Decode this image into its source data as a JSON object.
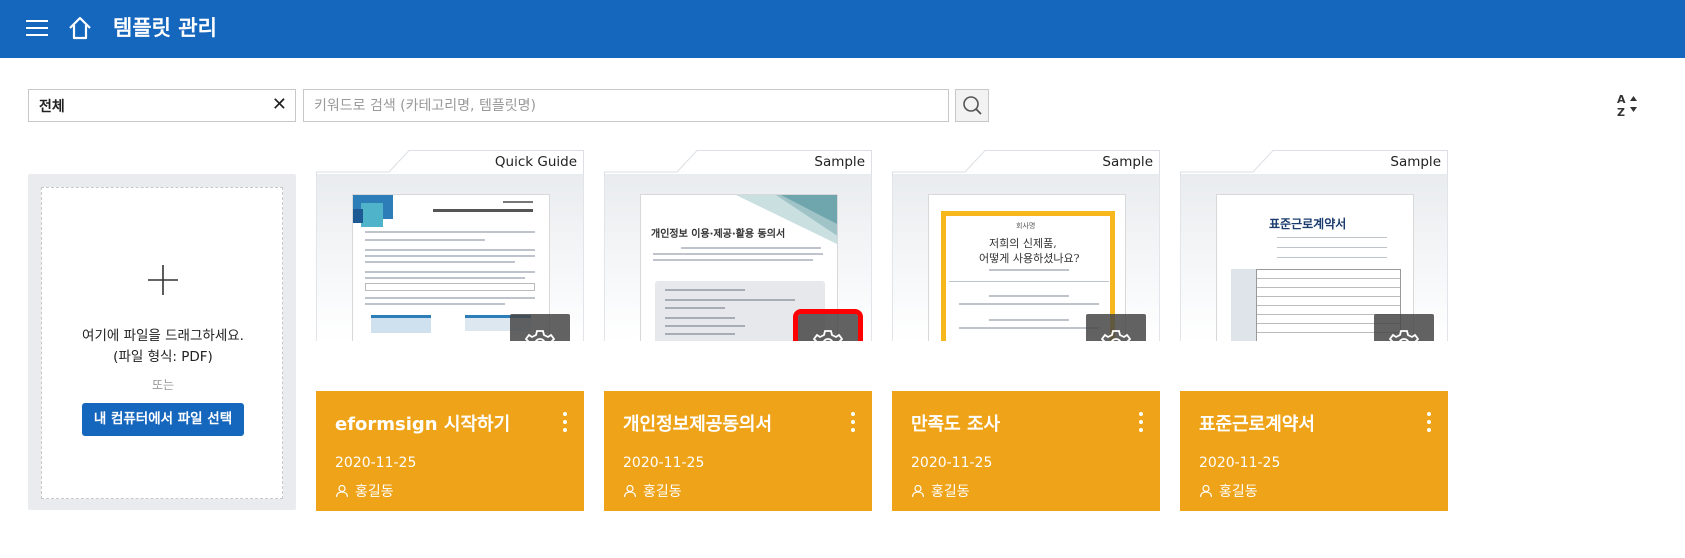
{
  "header": {
    "title": "템플릿 관리",
    "menu_icon": "hamburger-menu-icon",
    "home_icon": "home-icon"
  },
  "toolbar": {
    "filter_value": "전체",
    "filter_clear": "✕",
    "search_placeholder": "키워드로 검색 (카테고리명, 템플릿명)",
    "search_icon": "search-icon",
    "sort_icon": "sort-az-icon"
  },
  "upload": {
    "drag_text_line1": "여기에 파일을 드래그하세요.",
    "drag_text_line2": "(파일 형식: PDF)",
    "or_text": "또는",
    "select_button": "내 컴퓨터에서 파일 선택"
  },
  "cards": [
    {
      "tag": "Quick Guide",
      "name": "eformsign 시작하기",
      "date": "2020-11-25",
      "owner": "홍길동",
      "doc_title": "",
      "highlighted": false
    },
    {
      "tag": "Sample",
      "name": "개인정보제공동의서",
      "date": "2020-11-25",
      "owner": "홍길동",
      "doc_title": "개인정보 이용·제공·활용 동의서",
      "highlighted": true
    },
    {
      "tag": "Sample",
      "name": "만족도 조사",
      "date": "2020-11-25",
      "owner": "홍길동",
      "doc_title": "저희의 신제품,",
      "doc_title2": "어떻게 사용하셨나요?",
      "doc_badge": "회사명",
      "highlighted": false
    },
    {
      "tag": "Sample",
      "name": "표준근로계약서",
      "date": "2020-11-25",
      "owner": "홍길동",
      "doc_title": "표준근로계약서",
      "highlighted": false
    }
  ],
  "colors": {
    "header_bg": "#1566bd",
    "card_footer": "#eea319",
    "highlight": "#ff0000"
  }
}
